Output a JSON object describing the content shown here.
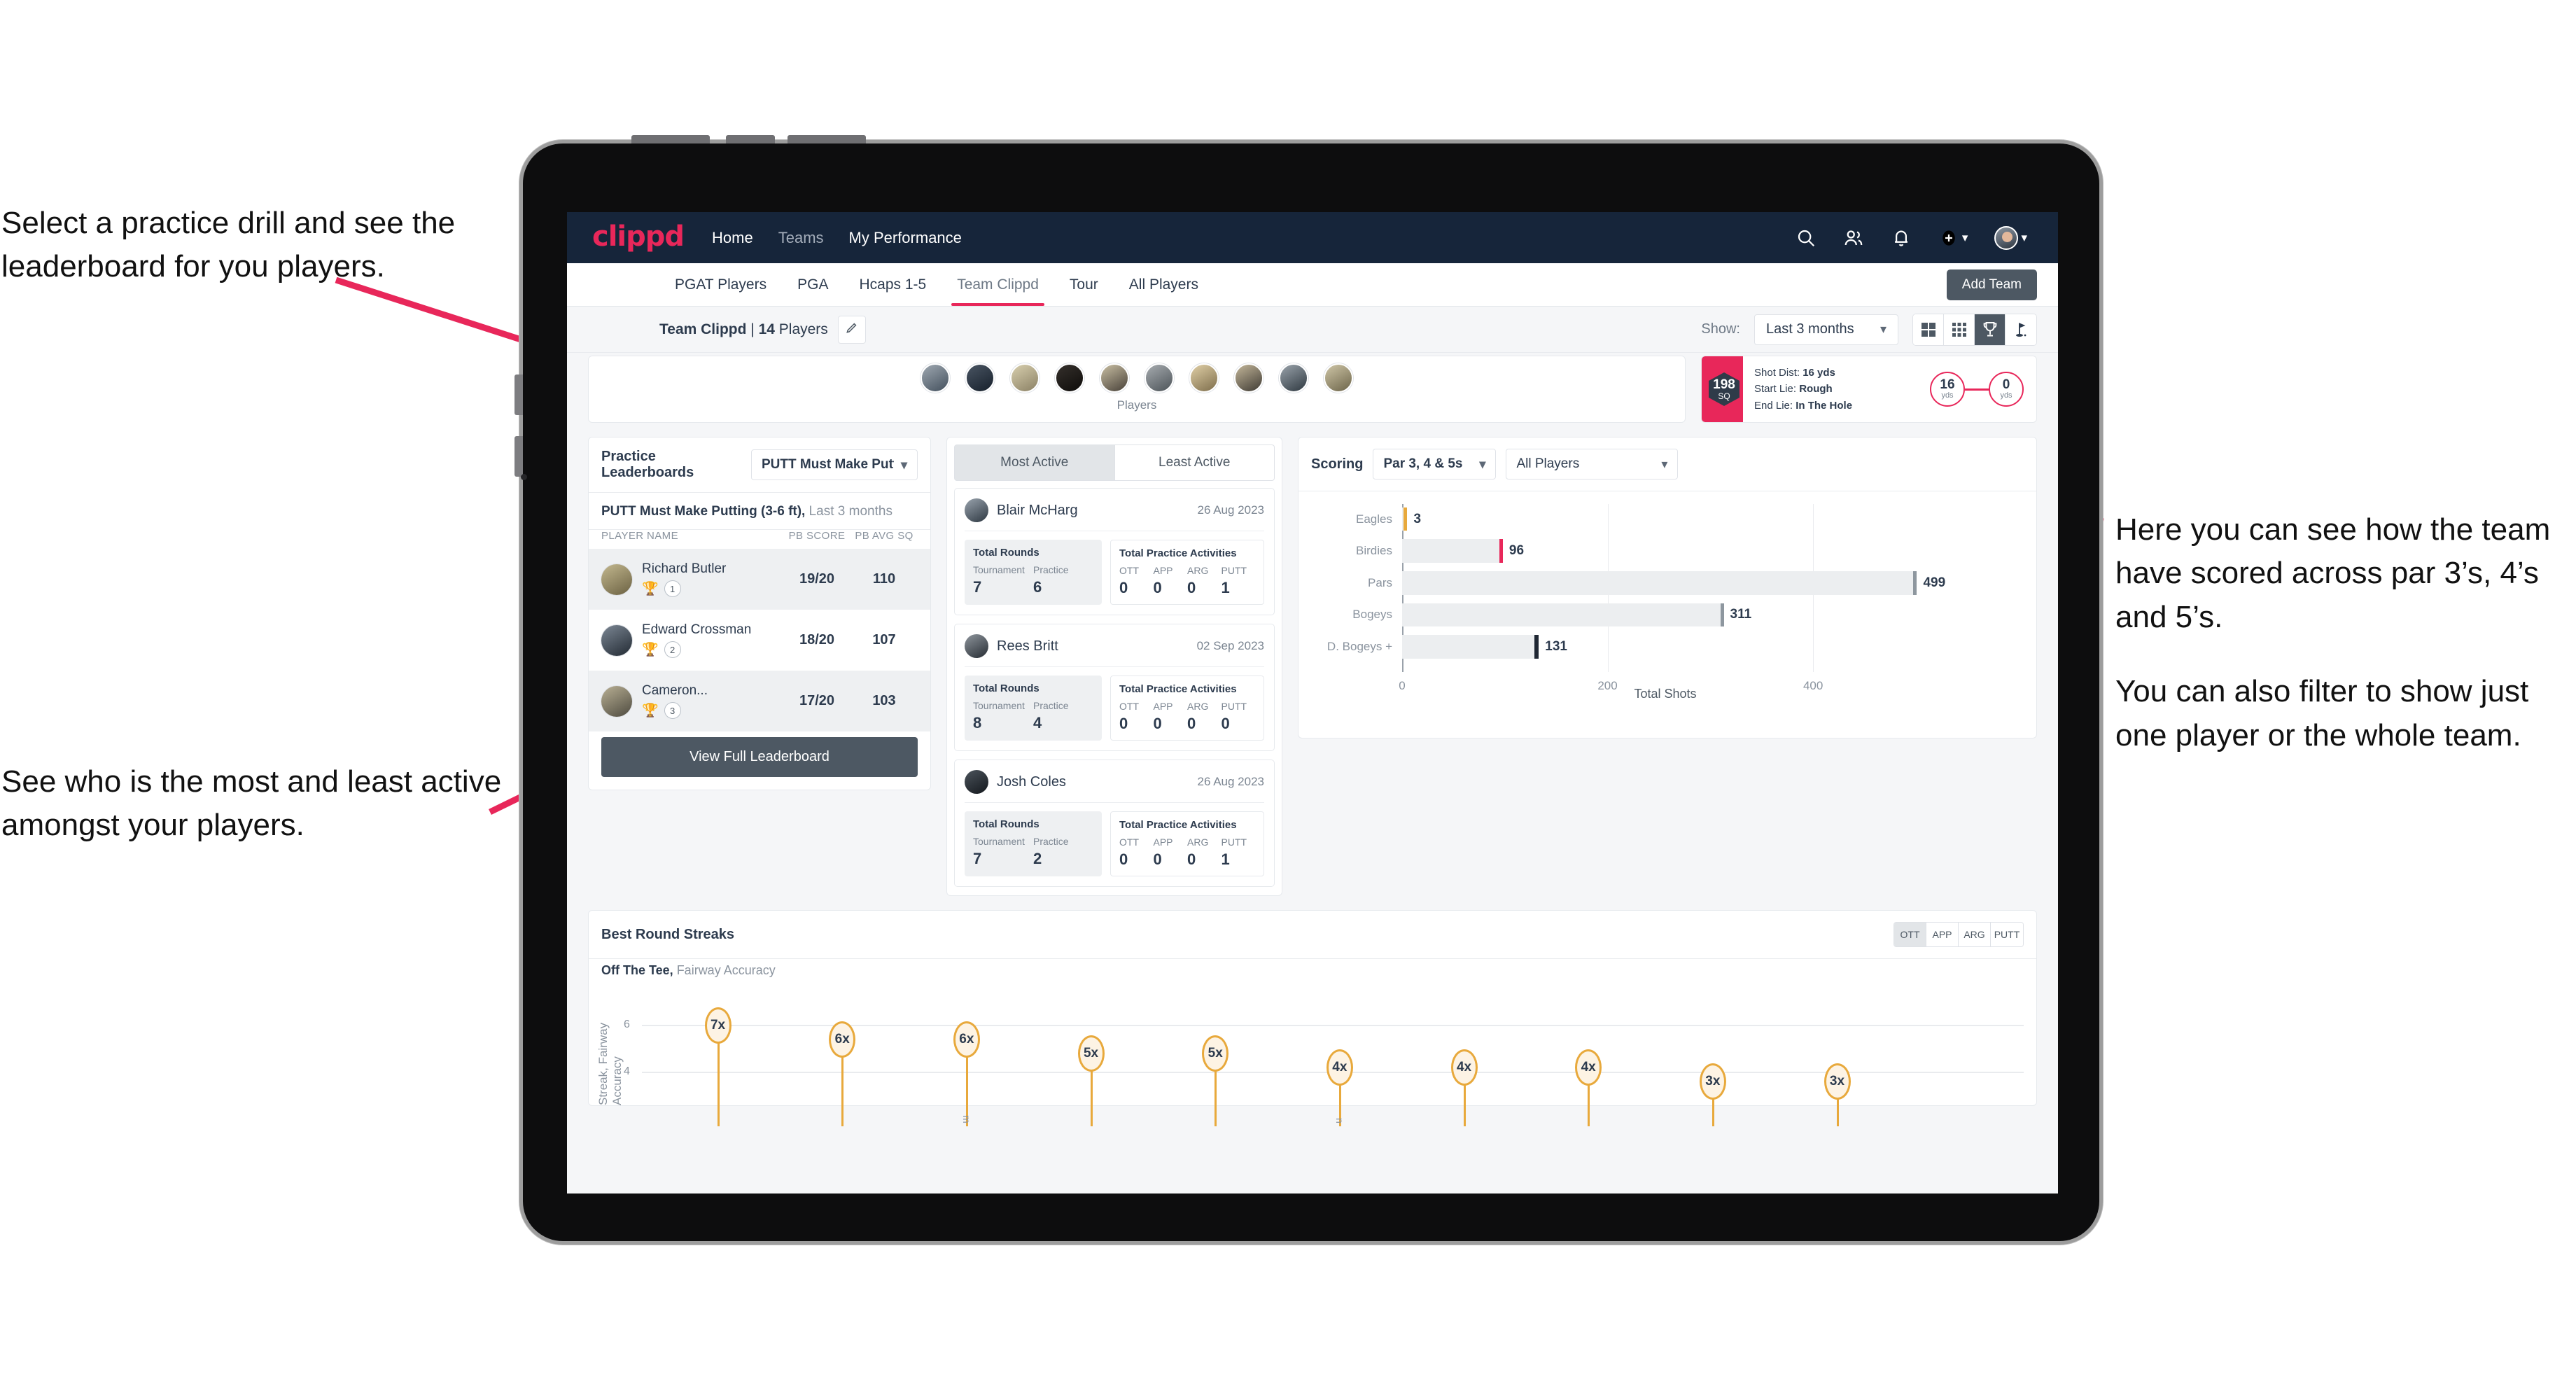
{
  "annotations": {
    "top_left": "Select a practice drill and see the leaderboard for you players.",
    "bottom_left": "See who is the most and least active amongst your players.",
    "right_1": "Here you can see how the team have scored across par 3’s, 4’s and 5’s.",
    "right_2": "You can also filter to show just one player or the whole team.",
    "arrow_color": "#e8275a"
  },
  "appbar": {
    "brand": "clippd",
    "nav": [
      {
        "label": "Home",
        "active": true
      },
      {
        "label": "Teams",
        "active": false
      },
      {
        "label": "My Performance",
        "active": true
      }
    ],
    "icons": [
      "search-icon",
      "people-icon",
      "bell-icon",
      "plus-circle-icon",
      "avatar"
    ],
    "background": "#16253a"
  },
  "tabs": {
    "items": [
      "PGAT Players",
      "PGA",
      "Hcaps 1-5",
      "Team Clippd",
      "Tour",
      "All Players"
    ],
    "active": "Team Clippd",
    "accent": "#e8275a",
    "add_team_label": "Add Team"
  },
  "toolbar": {
    "team_name": "Team Clippd",
    "separator": " | ",
    "player_count": "14",
    "players_word": " Players",
    "edit_icon": "pencil-icon",
    "show_label": "Show:",
    "range_value": "Last 3 months",
    "view_modes": [
      "grid-large-icon",
      "grid-small-icon",
      "trophy-icon",
      "flag-icon"
    ],
    "view_active_index": 2
  },
  "players_strip": {
    "label": "Players",
    "avatar_count": 10
  },
  "shot_card": {
    "sq_value": "198",
    "sq_label": "SQ",
    "lines": [
      {
        "key": "Shot Dist:",
        "value": "16 yds"
      },
      {
        "key": "Start Lie:",
        "value": "Rough"
      },
      {
        "key": "End Lie:",
        "value": "In The Hole"
      }
    ],
    "start_yds": "16",
    "start_unit": "yds",
    "end_yds": "0",
    "end_unit": "yds"
  },
  "leaderboard": {
    "title": "Practice Leaderboards",
    "drill_select": "PUTT Must Make Putting ...",
    "subtitle_bold": "PUTT Must Make Putting (3-6 ft),",
    "subtitle_rest": " Last 3 months",
    "columns": [
      "PLAYER NAME",
      "PB SCORE",
      "PB AVG SQ"
    ],
    "rows": [
      {
        "name": "Richard Butler",
        "rank": "1",
        "trophy": "gold",
        "pb_score": "19/20",
        "pb_avg_sq": "110"
      },
      {
        "name": "Edward Crossman",
        "rank": "2",
        "trophy": "silver",
        "pb_score": "18/20",
        "pb_avg_sq": "107"
      },
      {
        "name": "Cameron...",
        "rank": "3",
        "trophy": "bronze",
        "pb_score": "17/20",
        "pb_avg_sq": "103"
      }
    ],
    "view_full_label": "View Full Leaderboard"
  },
  "activity": {
    "tabs": [
      "Most Active",
      "Least Active"
    ],
    "active_tab": "Most Active",
    "rounds_title": "Total Rounds",
    "rounds_keys": [
      "Tournament",
      "Practice"
    ],
    "practice_title": "Total Practice Activities",
    "practice_keys": [
      "OTT",
      "APP",
      "ARG",
      "PUTT"
    ],
    "cards": [
      {
        "name": "Blair McHarg",
        "date": "26 Aug 2023",
        "tournament": "7",
        "practice": "6",
        "ott": "0",
        "app": "0",
        "arg": "0",
        "putt": "1"
      },
      {
        "name": "Rees Britt",
        "date": "02 Sep 2023",
        "tournament": "8",
        "practice": "4",
        "ott": "0",
        "app": "0",
        "arg": "0",
        "putt": "0"
      },
      {
        "name": "Josh Coles",
        "date": "26 Aug 2023",
        "tournament": "7",
        "practice": "2",
        "ott": "0",
        "app": "0",
        "arg": "0",
        "putt": "1"
      }
    ]
  },
  "scoring": {
    "title": "Scoring",
    "par_filter": "Par 3, 4 & 5s",
    "player_filter": "All Players"
  },
  "streaks": {
    "title": "Best Round Streaks",
    "segments": [
      "OTT",
      "APP",
      "ARG",
      "PUTT"
    ],
    "segment_active": "OTT",
    "subtitle_bold": "Off The Tee,",
    "subtitle_rest": " Fairway Accuracy",
    "y_axis_label": "Streak, Fairway Accuracy"
  },
  "chart_data": [
    {
      "type": "bar",
      "orientation": "horizontal",
      "title": "Scoring",
      "categories": [
        "Eagles",
        "Birdies",
        "Pars",
        "Bogeys",
        "D. Bogeys +"
      ],
      "values": [
        3,
        96,
        499,
        311,
        131
      ],
      "cap_colors": [
        "#e8a93c",
        "#e8275a",
        "#8e979f",
        "#8e979f",
        "#1f2733"
      ],
      "xlabel": "Total Shots",
      "ylabel": "",
      "xlim": [
        0,
        560
      ],
      "xticks": [
        0,
        200,
        400
      ],
      "grid": true,
      "legend": "none"
    },
    {
      "type": "bar",
      "orientation": "vertical",
      "title": "Best Round Streaks — Off The Tee, Fairway Accuracy",
      "categories": [
        "",
        "",
        "m",
        "",
        "",
        "n",
        "",
        "",
        "",
        ""
      ],
      "values": [
        7,
        6,
        6,
        5,
        5,
        4,
        4,
        4,
        3,
        3
      ],
      "labels": [
        "7x",
        "6x",
        "6x",
        "5x",
        "5x",
        "4x",
        "4x",
        "4x",
        "3x",
        "3x"
      ],
      "ylabel": "Streak, Fairway Accuracy",
      "xlabel": "",
      "ylim": [
        0,
        8
      ],
      "yticks": [
        4,
        6
      ],
      "grid": true,
      "marker_color": "#e8a93c",
      "marker_fill": "#fdf3e4"
    }
  ]
}
